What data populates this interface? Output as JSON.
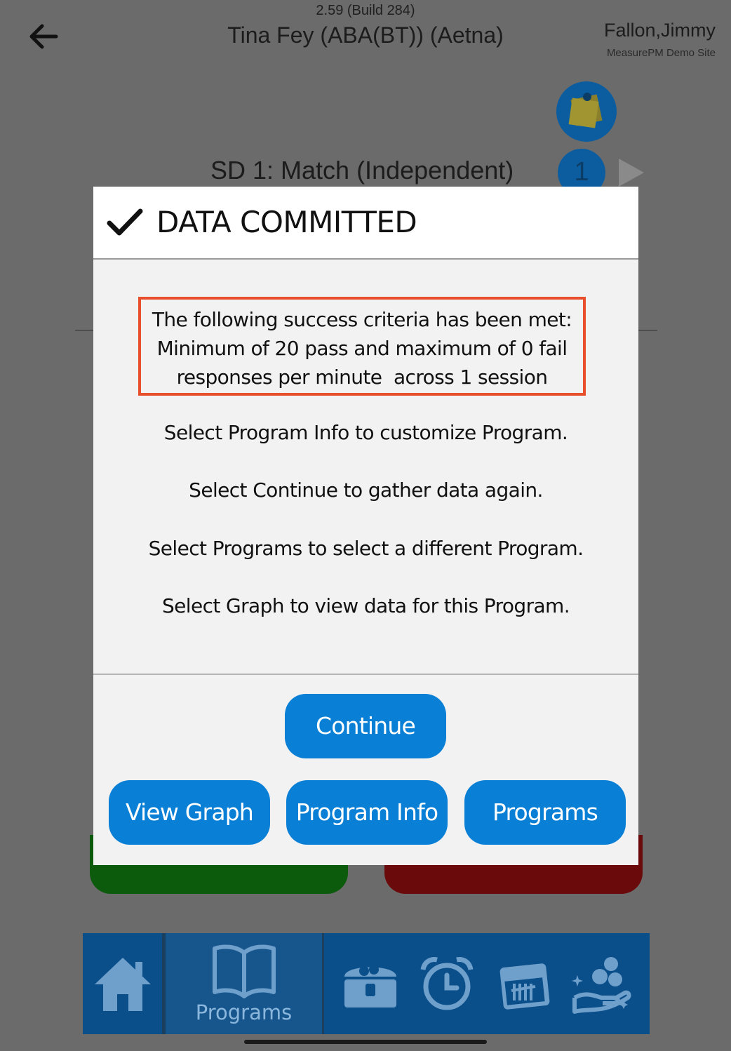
{
  "header": {
    "version": "2.59 (Build 284)",
    "session_title": "Tina Fey (ABA(BT)) (Aetna)",
    "user_name": "Fallon,Jimmy",
    "site_name": "MeasurePM Demo Site"
  },
  "program": {
    "sd_label": "SD 1: Match (Independent)",
    "count": "1"
  },
  "modal": {
    "title": "DATA COMMITTED",
    "criteria_lines": [
      "The following success criteria has been met:",
      "Minimum of 20 pass and maximum of 0 fail",
      "responses per minute  across 1 session"
    ],
    "messages": [
      "Select Program Info to customize Program.",
      "Select Continue to gather data again.",
      "Select Programs to select a different Program.",
      "Select Graph to view data for this Program."
    ],
    "buttons": {
      "continue": "Continue",
      "view_graph": "View Graph",
      "program_info": "Program Info",
      "programs": "Programs"
    }
  },
  "bottom_nav": {
    "programs_label": "Programs",
    "items": [
      "home-icon",
      "book-icon",
      "treasure-chest-icon",
      "alarm-clock-icon",
      "calendar-icon",
      "coins-hand-icon"
    ]
  },
  "colors": {
    "accent": "#0a7fd6",
    "highlight_border": "#e8502c",
    "nav_bg": "#0b4f8a"
  }
}
